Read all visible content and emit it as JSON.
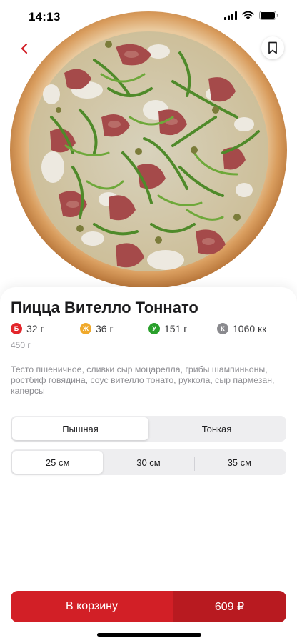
{
  "status_bar": {
    "time": "14:13"
  },
  "product": {
    "title": "Пицца Вителло Тоннато",
    "nutrition": [
      {
        "badge": "Б",
        "value": "32 г",
        "color": "#e3262b"
      },
      {
        "badge": "Ж",
        "value": "36 г",
        "color": "#f0a92b"
      },
      {
        "badge": "У",
        "value": "151 г",
        "color": "#2aa02c"
      },
      {
        "badge": "К",
        "value": "1060 кк",
        "color": "#8a8a8e"
      }
    ],
    "weight": "450 г",
    "description": "Тесто пшеничное, сливки сыр моцарелла, грибы шампиньоны, ростбиф говядина, соус вителло тонато, руккола, сыр пармезан, каперсы"
  },
  "dough_options": {
    "selected": "Пышная",
    "items": [
      "Пышная",
      "Тонкая"
    ]
  },
  "size_options": {
    "selected": "25 см",
    "items": [
      "25 см",
      "30 см",
      "35 см"
    ]
  },
  "cart": {
    "label": "В корзину",
    "price": "609 ₽"
  },
  "colors": {
    "accent": "#d21f26",
    "accent_dark": "#b81a20"
  },
  "icons": {
    "back": "chevron-left-icon",
    "bookmark": "bookmark-icon"
  }
}
